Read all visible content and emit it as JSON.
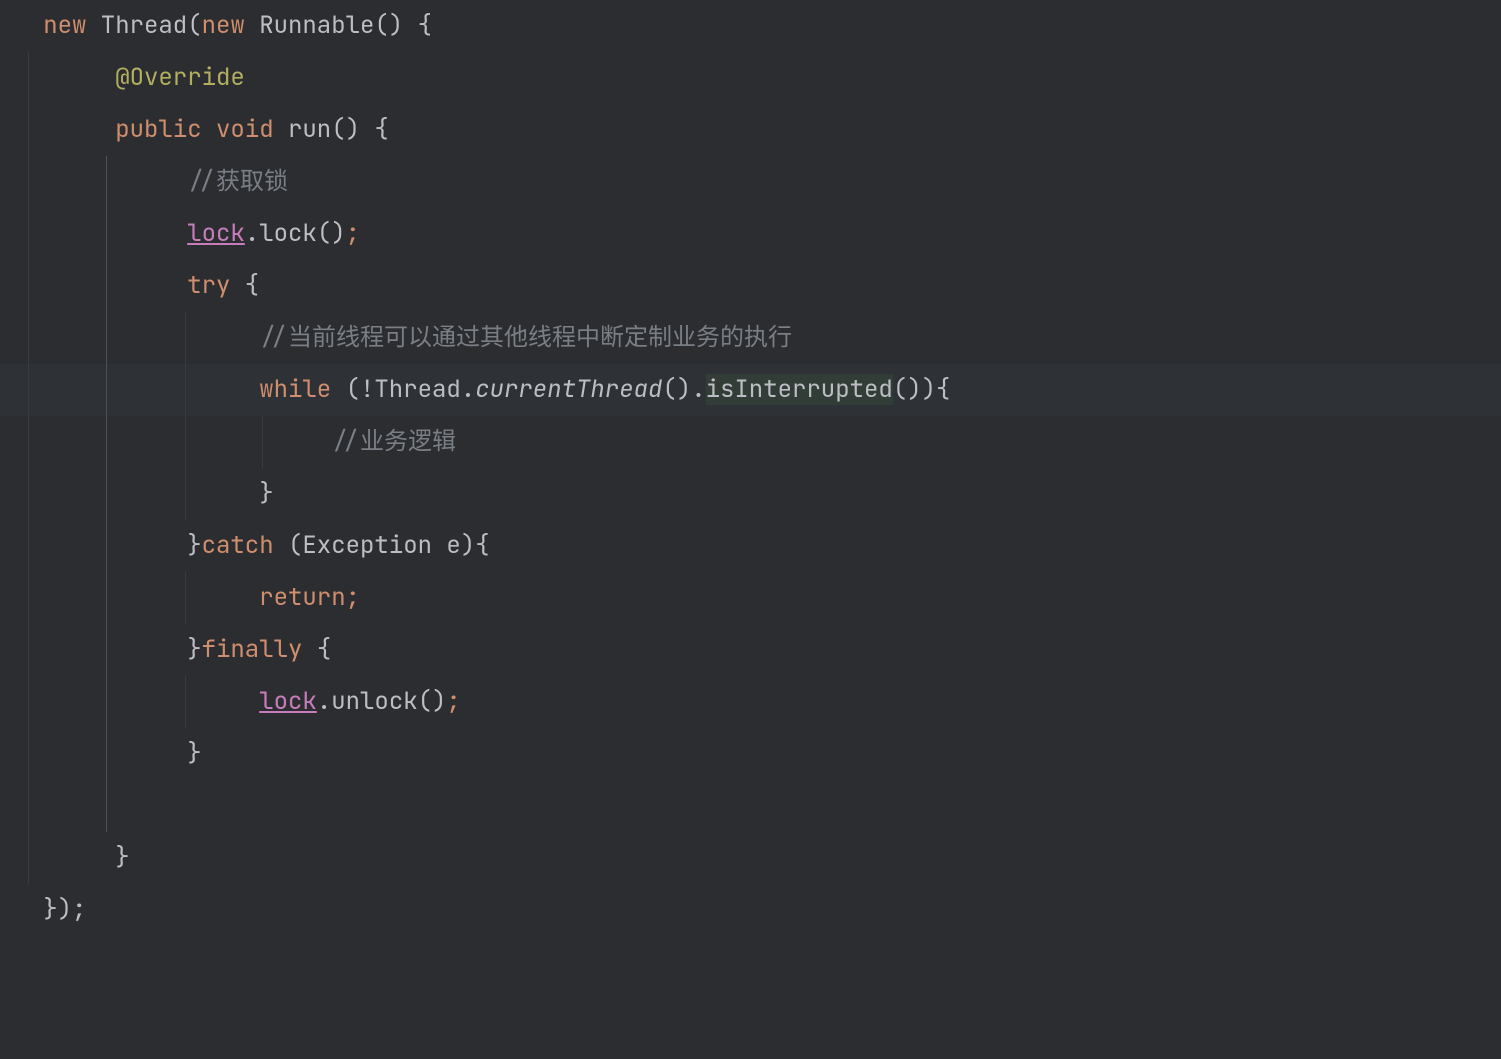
{
  "code": {
    "line1": {
      "new1": "new",
      "thread": " Thread(",
      "new2": "new",
      "runnable": " Runnable() {"
    },
    "line2": {
      "annotation": "@Override"
    },
    "line3": {
      "public": "public",
      "void": " void",
      "run": " run",
      "parens": "() {"
    },
    "line4": {
      "comment": "//获取锁"
    },
    "line5": {
      "lock": "lock",
      "dot": ".",
      "method": "lock()",
      "semi": ";"
    },
    "line6": {
      "try": "try",
      "brace": " {"
    },
    "line7": {
      "comment": "//当前线程可以通过其他线程中断定制业务的执行"
    },
    "line8": {
      "while": "while",
      "open": " (!Thread.",
      "current": "currentThread",
      "paren": "().",
      "isint": "isInterrupted",
      "close": "()){"
    },
    "line9": {
      "comment": "//业务逻辑"
    },
    "line10": {
      "brace": "}"
    },
    "line11": {
      "brace": "}",
      "catch": "catch",
      "exc": " (Exception e){"
    },
    "line12": {
      "return": "return",
      "semi": ";"
    },
    "line13": {
      "brace": "}",
      "finally": "finally",
      "open": " {"
    },
    "line14": {
      "lock": "lock",
      "dot": ".",
      "method": "unlock()",
      "semi": ";"
    },
    "line15": {
      "brace": "}"
    },
    "line17": {
      "brace": "}"
    },
    "line18": {
      "close": "});"
    }
  }
}
